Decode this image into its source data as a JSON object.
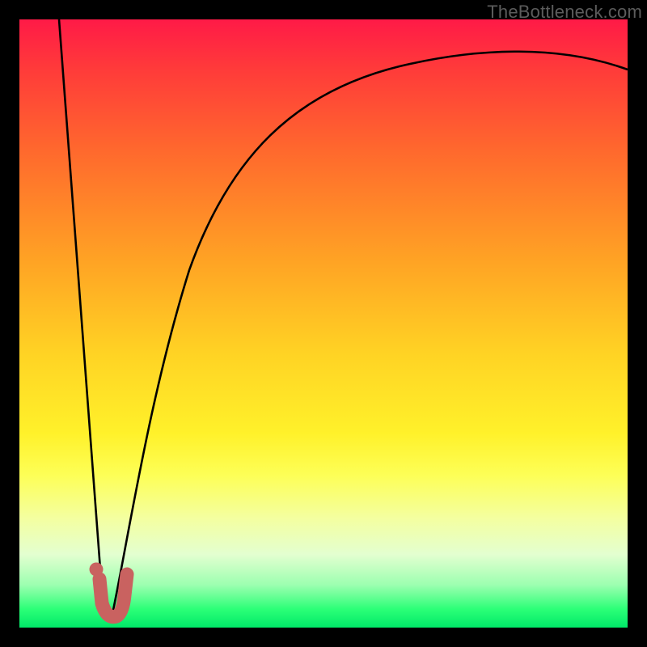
{
  "watermark": "TheBottleneck.com",
  "colors": {
    "curve": "#000000",
    "marker": "#c96260",
    "background_frame": "#000000"
  },
  "chart_data": {
    "type": "line",
    "title": "",
    "xlabel": "",
    "ylabel": "",
    "xlim": [
      0,
      100
    ],
    "ylim": [
      0,
      100
    ],
    "grid": false,
    "legend": false,
    "series": [
      {
        "name": "left-branch",
        "x": [
          6.5,
          7.5,
          8.5,
          9.5,
          10.5,
          11.5,
          12.5,
          13.0,
          13.6
        ],
        "y": [
          100,
          86,
          72,
          58,
          44,
          30,
          16,
          8,
          3
        ]
      },
      {
        "name": "right-branch",
        "x": [
          15.0,
          16.0,
          17.5,
          19.0,
          21.0,
          24.0,
          28.0,
          33.0,
          39.0,
          46.0,
          54.0,
          63.0,
          73.0,
          84.0,
          95.0,
          100.0
        ],
        "y": [
          2,
          8,
          16,
          24,
          34,
          46,
          58,
          67,
          74,
          79,
          83,
          86,
          88.5,
          90,
          91,
          91.5
        ]
      }
    ],
    "marker": {
      "name": "j-shaped-overlay",
      "points": [
        {
          "x": 12.8,
          "y": 7.0
        },
        {
          "x": 13.2,
          "y": 3.5
        },
        {
          "x": 14.0,
          "y": 1.8
        },
        {
          "x": 15.0,
          "y": 1.5
        },
        {
          "x": 15.8,
          "y": 2.5
        },
        {
          "x": 16.5,
          "y": 5.0
        },
        {
          "x": 17.0,
          "y": 8.0
        }
      ],
      "dot": {
        "x": 12.6,
        "y": 8.5
      }
    }
  }
}
